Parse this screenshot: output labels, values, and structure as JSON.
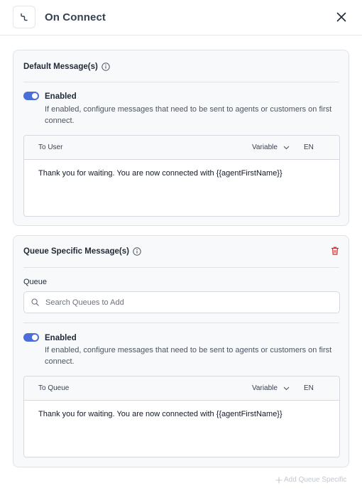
{
  "header": {
    "title": "On Connect",
    "flow_icon": "flow-step-icon",
    "close_icon": "close-icon"
  },
  "default_card": {
    "title": "Default Message(s)",
    "toggle": {
      "enabled": true,
      "label": "Enabled",
      "description": "If enabled, configure messages that need to be sent to agents or customers on first connect."
    },
    "message": {
      "to_label": "To User",
      "variable_label": "Variable",
      "language": "EN",
      "text": "Thank you for waiting. You are now connected with {{agentFirstName}}"
    }
  },
  "queue_card": {
    "title": "Queue Specific Message(s)",
    "queue_label": "Queue",
    "search_placeholder": "Search Queues to Add",
    "toggle": {
      "enabled": true,
      "label": "Enabled",
      "description": "If enabled, configure messages that need to be sent to agents or customers on first connect."
    },
    "message": {
      "to_label": "To Queue",
      "variable_label": "Variable",
      "language": "EN",
      "text": "Thank you for waiting. You are now connected with {{agentFirstName}}"
    }
  },
  "footer": {
    "add_label": "Add Queue Specific"
  },
  "colors": {
    "accent": "#4b6fd9",
    "danger": "#dc2626",
    "disabled_text": "#c3c8d0"
  }
}
